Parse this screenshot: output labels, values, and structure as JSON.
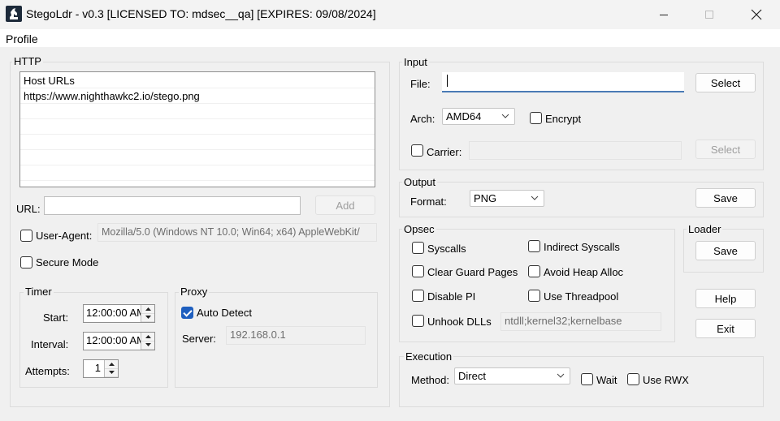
{
  "window": {
    "title": "StegoLdr - v0.3 [LICENSED TO: mdsec__qa] [EXPIRES: 09/08/2024]"
  },
  "menu": {
    "profile": "Profile"
  },
  "http": {
    "label": "HTTP",
    "list_header": "Host URLs",
    "urls": [
      "https://www.nighthawkc2.io/stego.png"
    ],
    "url_label": "URL:",
    "url_value": "",
    "add_button": "Add",
    "user_agent_label": "User-Agent:",
    "user_agent_checked": false,
    "user_agent_value": "Mozilla/5.0 (Windows NT 10.0; Win64; x64) AppleWebKit/",
    "secure_mode_label": "Secure Mode",
    "secure_mode_checked": false
  },
  "timer": {
    "label": "Timer",
    "start_label": "Start:",
    "start_value": "12:00:00 AM",
    "interval_label": "Interval:",
    "interval_value": "12:00:00 AM",
    "attempts_label": "Attempts:",
    "attempts_value": "1"
  },
  "proxy": {
    "label": "Proxy",
    "auto_detect_label": "Auto Detect",
    "auto_detect_checked": true,
    "server_label": "Server:",
    "server_value": "192.168.0.1"
  },
  "input": {
    "label": "Input",
    "file_label": "File:",
    "file_value": "",
    "select_button": "Select",
    "arch_label": "Arch:",
    "arch_value": "AMD64",
    "encrypt_label": "Encrypt",
    "encrypt_checked": false,
    "carrier_label": "Carrier:",
    "carrier_checked": false,
    "carrier_value": "",
    "carrier_select_button": "Select"
  },
  "output": {
    "label": "Output",
    "format_label": "Format:",
    "format_value": "PNG",
    "save_button": "Save"
  },
  "opsec": {
    "label": "Opsec",
    "syscalls": "Syscalls",
    "indirect_syscalls": "Indirect Syscalls",
    "clear_guard_pages": "Clear Guard Pages",
    "avoid_heap_alloc": "Avoid Heap Alloc",
    "disable_pi": "Disable PI",
    "use_threadpool": "Use Threadpool",
    "unhook_dlls": "Unhook DLLs",
    "unhook_dlls_value": "ntdll;kernel32;kernelbase"
  },
  "loader": {
    "label": "Loader",
    "save_button": "Save"
  },
  "help_button": "Help",
  "exit_button": "Exit",
  "execution": {
    "label": "Execution",
    "method_label": "Method:",
    "method_value": "Direct",
    "wait_label": "Wait",
    "wait_checked": false,
    "use_rwx_label": "Use RWX",
    "use_rwx_checked": false
  },
  "colors": {
    "window_bg": "#f0f0f0",
    "accent": "#1f5fbf",
    "focus_underline": "#4a7ab5"
  }
}
